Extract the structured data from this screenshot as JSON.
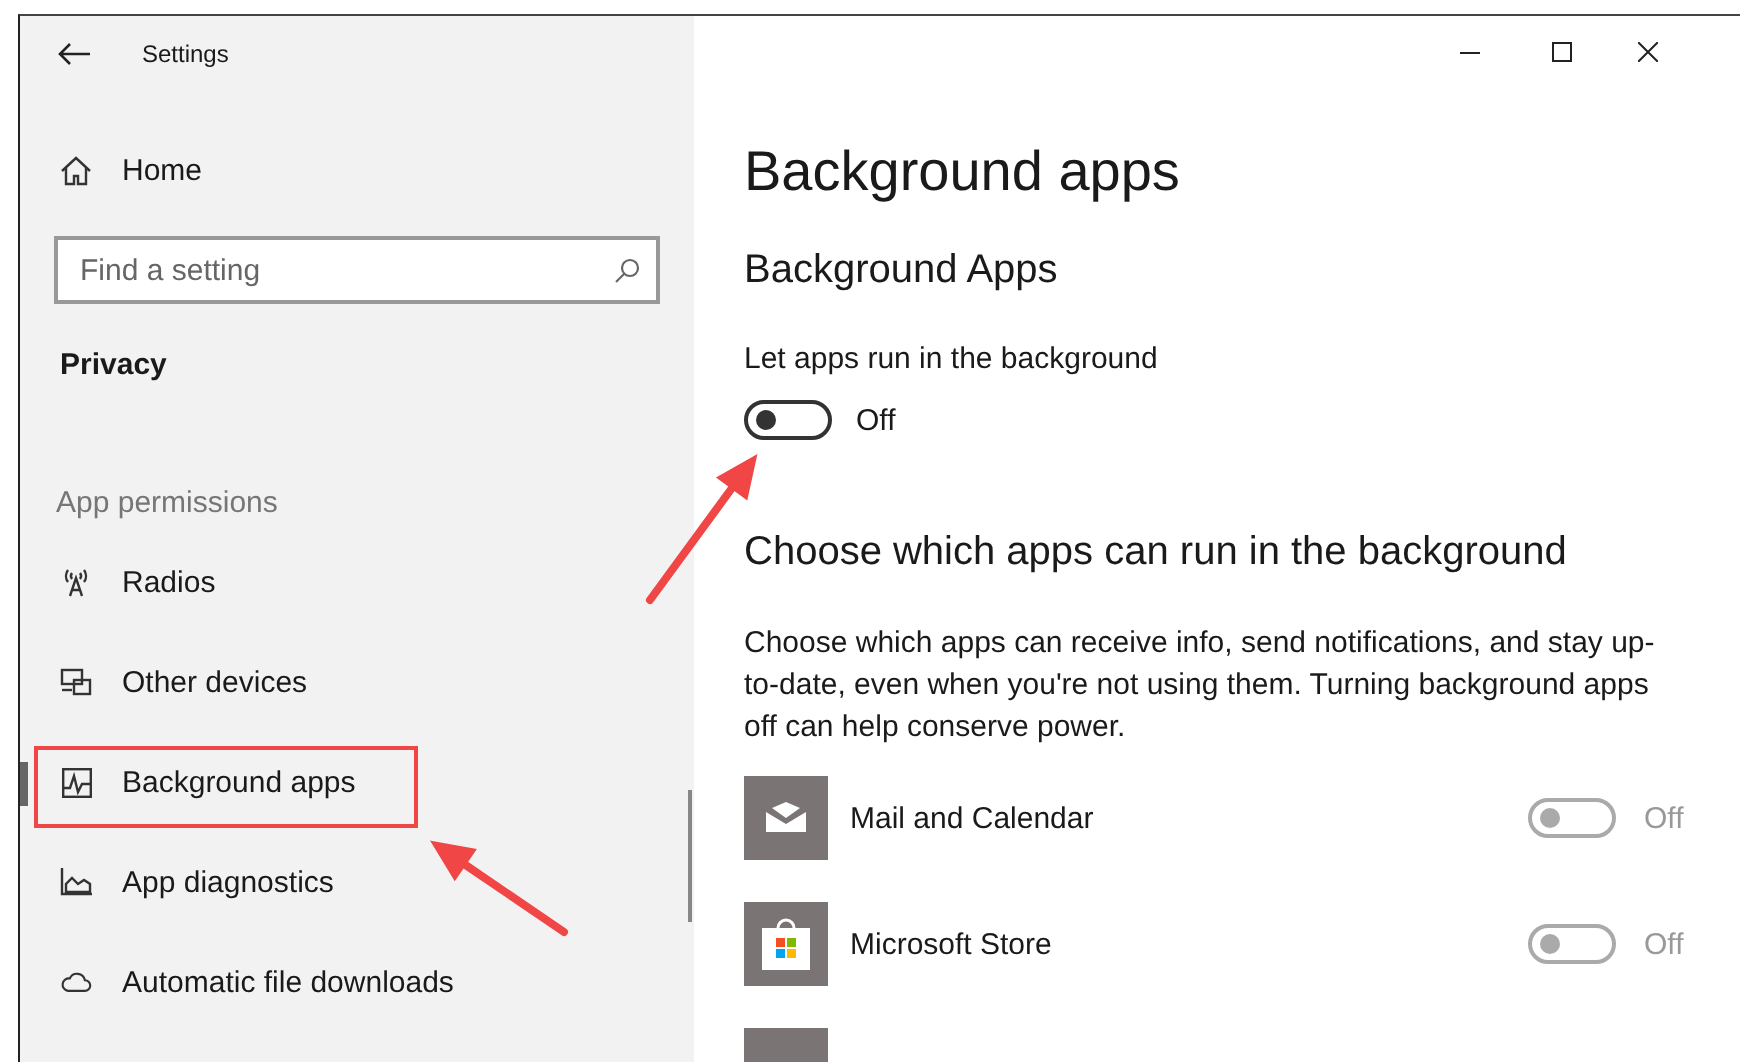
{
  "window": {
    "title": "Settings"
  },
  "sidebar": {
    "home": "Home",
    "search": {
      "placeholder": "Find a setting"
    },
    "section": "Privacy",
    "group_label": "App permissions",
    "items": [
      {
        "label": "Radios",
        "selected": false
      },
      {
        "label": "Other devices",
        "selected": false
      },
      {
        "label": "Background apps",
        "selected": true
      },
      {
        "label": "App diagnostics",
        "selected": false
      },
      {
        "label": "Automatic file downloads",
        "selected": false
      }
    ]
  },
  "content": {
    "title": "Background apps",
    "section_title": "Background Apps",
    "master": {
      "label": "Let apps run in the background",
      "on": false,
      "state_text": "Off"
    },
    "apps_heading": "Choose which apps can run in the background",
    "description": "Choose which apps can receive info, send notifications, and stay up-to-date, even when you're not using them. Turning background apps off can help conserve power.",
    "apps": [
      {
        "name": "Mail and Calendar",
        "on": false,
        "disabled": true,
        "state_text": "Off"
      },
      {
        "name": "Microsoft Store",
        "on": false,
        "disabled": true,
        "state_text": "Off"
      }
    ]
  }
}
